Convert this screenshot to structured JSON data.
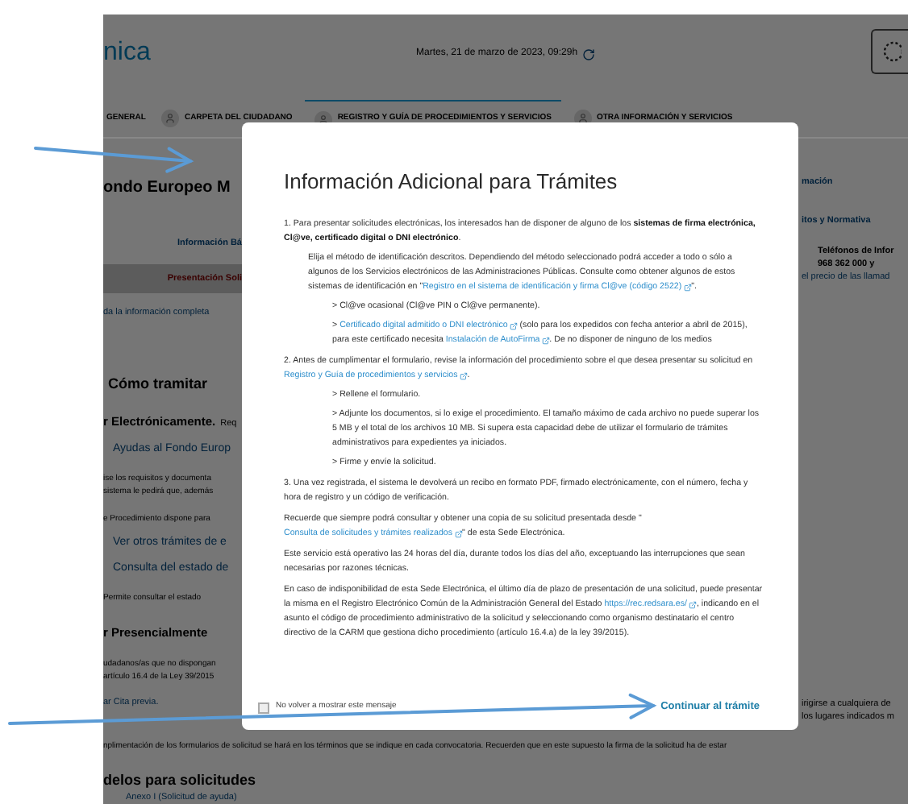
{
  "header": {
    "logo_text": "nica",
    "date": "Martes, 21 de marzo de 2023, 09:29h"
  },
  "nav": [
    {
      "label": "GENERAL",
      "icon": false,
      "selected": false
    },
    {
      "label": "CARPETA DEL CIUDADANO",
      "icon": true,
      "selected": false
    },
    {
      "label": "REGISTRO Y GUÍA DE PROCEDIMIENTOS Y SERVICIOS",
      "icon": true,
      "selected": true
    },
    {
      "label": "OTRA INFORMACIÓN Y SERVICIOS",
      "icon": true,
      "selected": false
    }
  ],
  "left_column": [
    {
      "kind": "title",
      "lines": [
        "ondo Europeo M"
      ]
    },
    {
      "kind": "tab",
      "selected": false,
      "lines": [
        "Información Bá"
      ]
    },
    {
      "kind": "tab",
      "selected": true,
      "lines": [
        "Presentación Soli"
      ]
    },
    {
      "kind": "link",
      "lines": [
        "da la información completa"
      ]
    },
    {
      "kind": "h2",
      "lines": [
        "Cómo tramitar"
      ]
    },
    {
      "kind": "h3",
      "lines": [
        "r Electrónicamente."
      ],
      "note": "Req"
    },
    {
      "kind": "biglink",
      "lines": [
        "Ayudas al Fondo Europ"
      ]
    },
    {
      "kind": "para",
      "lines": [
        "ise los requisitos y documenta",
        "sistema le pedirá que, además"
      ]
    },
    {
      "kind": "para",
      "lines": [
        "e Procedimiento dispone para"
      ]
    },
    {
      "kind": "biglink",
      "lines": [
        "Ver otros trámites de e"
      ]
    },
    {
      "kind": "biglink",
      "lines": [
        "Consulta del estado de"
      ]
    },
    {
      "kind": "para",
      "lines": [
        "Permite consultar el estado"
      ]
    },
    {
      "kind": "h3",
      "lines": [
        "r Presencialmente"
      ]
    },
    {
      "kind": "para",
      "lines": [
        "udadanos/as que no dispongan",
        "artículo 16.4 de la Ley 39/2015"
      ]
    },
    {
      "kind": "link",
      "lines": [
        "ar Cita previa."
      ]
    }
  ],
  "right_column": [
    {
      "kind": "tab",
      "lines": [
        "mación"
      ]
    },
    {
      "kind": "tab",
      "lines": [
        "itos y Normativa"
      ]
    },
    {
      "kind": "phone",
      "lines": [
        "Teléfonos de Infor",
        "968 362 000 y"
      ]
    },
    {
      "kind": "link",
      "lines": [
        "el precio de las llamad"
      ]
    },
    {
      "kind": "bottom",
      "lines": [
        "irigirse a cualquiera de",
        "los lugares indicados m"
      ]
    }
  ],
  "bottom_note": "nplimentación de los formularios de solicitud se hará en los términos que se indique en cada convocatoria. Recuerden que en este supuesto la firma de la solicitud ha de estar",
  "bottom_heading": "delos para solicitudes",
  "bottom_link": "Anexo I (Solicitud de ayuda)",
  "modal": {
    "title": "Información Adicional para Trámites",
    "paragraphs": [
      {
        "kind": "para",
        "segments": [
          {
            "kind": "text",
            "text": "1. Para presentar solicitudes electrónicas, los interesados han de disponer de alguno de los "
          },
          {
            "kind": "bold",
            "text": "sistemas de firma electrónica, Cl@ve, certificado digital o DNI electrónico"
          },
          {
            "kind": "text",
            "text": "."
          }
        ],
        "children": [
          {
            "kind": "para",
            "segments": [
              {
                "kind": "text",
                "text": "Elija el método de identificación descritos. Dependiendo del método seleccionado podrá acceder a todo o sólo a algunos de los Servicios electrónicos de las Administraciones Públicas. Consulte como obtener algunos de estos sistemas de identificación en \""
              },
              {
                "kind": "link",
                "text": "Registro en el sistema de identificación y firma Cl@ve (código 2522)"
              },
              {
                "kind": "text",
                "text": "\"."
              }
            ]
          },
          {
            "kind": "bullet",
            "segments": [
              {
                "kind": "text",
                "text": "> Cl@ve ocasional (Cl@ve PIN o Cl@ve permanente)."
              }
            ]
          },
          {
            "kind": "bullet",
            "segments": [
              {
                "kind": "text",
                "text": "> "
              },
              {
                "kind": "link",
                "text": "Certificado digital admitido o DNI electrónico"
              },
              {
                "kind": "text",
                "text": " (solo para los expedidos con fecha anterior a abril de 2015), para este certificado necesita "
              },
              {
                "kind": "link",
                "text": "Instalación de AutoFirma"
              },
              {
                "kind": "text",
                "text": ". De no disponer de ninguno de los medios"
              }
            ]
          }
        ]
      },
      {
        "kind": "para",
        "segments": [
          {
            "kind": "text",
            "text": "2. Antes de cumplimentar el formulario, revise la información del procedimiento sobre el que desea presentar su solicitud en "
          },
          {
            "kind": "link",
            "text": "Registro y Guía de procedimientos y servicios"
          },
          {
            "kind": "text",
            "text": "."
          }
        ],
        "children": [
          {
            "kind": "bullet",
            "segments": [
              {
                "kind": "text",
                "text": "> Rellene el formulario."
              }
            ]
          },
          {
            "kind": "bullet",
            "segments": [
              {
                "kind": "text",
                "text": "> Adjunte los documentos, si lo exige el procedimiento. El tamaño máximo de cada archivo no puede superar los 5 MB y el total de los archivos 10 MB. Si supera esta capacidad debe de utilizar el formulario de trámites administrativos para expedientes ya iniciados."
              }
            ]
          },
          {
            "kind": "bullet",
            "segments": [
              {
                "kind": "text",
                "text": "> Firme y envíe la solicitud."
              }
            ]
          }
        ]
      },
      {
        "kind": "para",
        "segments": [
          {
            "kind": "text",
            "text": "3. Una vez registrada, el sistema le devolverá un recibo en formato PDF, firmado electrónicamente, con el número, fecha y hora de registro y un código de verificación."
          }
        ]
      },
      {
        "kind": "para",
        "segments": [
          {
            "kind": "text",
            "text": "Recuerde que siempre podrá consultar y obtener una copia de su solicitud presentada desde \""
          },
          {
            "kind": "link",
            "text": "Consulta de solicitudes y trámites realizados"
          },
          {
            "kind": "text",
            "text": "\" de esta Sede Electrónica."
          }
        ]
      },
      {
        "kind": "para",
        "segments": [
          {
            "kind": "text",
            "text": "Este servicio está operativo las 24 horas del día, durante todos los días del año, exceptuando las interrupciones que sean necesarias por razones técnicas."
          }
        ]
      },
      {
        "kind": "para",
        "segments": [
          {
            "kind": "text",
            "text": "En caso de indisponibilidad de esta Sede Electrónica, el último día de plazo de presentación de una solicitud, puede presentar la misma en el Registro Electrónico Común de la Administración General del Estado "
          },
          {
            "kind": "link",
            "text": "https://rec.redsara.es/"
          },
          {
            "kind": "text",
            "text": ", indicando en el asunto el código de procedimiento administrativo de la solicitud y seleccionando como organismo destinatario el centro directivo de la CARM que gestiona dicho procedimiento (artículo 16.4.a) de la ley 39/2015)."
          }
        ]
      }
    ],
    "dont_show_again": {
      "label": "No volver a mostrar este mensaje",
      "checked": false
    },
    "continue_button": "Continuar al trámite"
  }
}
